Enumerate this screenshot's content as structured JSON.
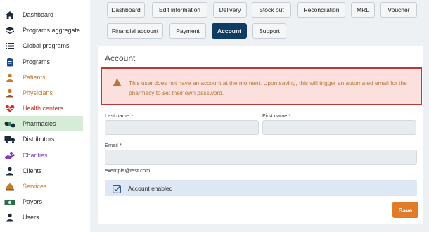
{
  "sidebar": {
    "items": [
      {
        "label": "Dashboard",
        "icon": "home-icon",
        "color": "#2b2b2b"
      },
      {
        "label": "Programs aggregate",
        "icon": "layers-icon",
        "color": "#2b2b2b"
      },
      {
        "label": "Global programs",
        "icon": "list-icon",
        "color": "#2b2b2b"
      },
      {
        "label": "Programs",
        "icon": "clipboard-icon",
        "color": "#2b2b2b"
      },
      {
        "label": "Patients",
        "icon": "patient-icon",
        "color": "#c57a2c"
      },
      {
        "label": "Physicians",
        "icon": "physician-icon",
        "color": "#c57a2c"
      },
      {
        "label": "Health centers",
        "icon": "heart-pulse-icon",
        "color": "#c0392b"
      },
      {
        "label": "Pharmacies",
        "icon": "pills-icon",
        "color": "#2b2b2b"
      },
      {
        "label": "Distributors",
        "icon": "truck-icon",
        "color": "#2b2b2b"
      },
      {
        "label": "Charities",
        "icon": "charity-hand-icon",
        "color": "#7b3fbf"
      },
      {
        "label": "Clients",
        "icon": "user-icon",
        "color": "#2b2b2b"
      },
      {
        "label": "Services",
        "icon": "bell-icon",
        "color": "#c57a2c"
      },
      {
        "label": "Payors",
        "icon": "money-icon",
        "color": "#2b2b2b"
      },
      {
        "label": "Users",
        "icon": "users-icon",
        "color": "#2b2b2b"
      }
    ],
    "active": "Pharmacies"
  },
  "tabs": {
    "dashboard": "Dashboard",
    "edit_information": "Edit information",
    "delivery": "Delivery",
    "stock_out": "Stock out",
    "reconciliation": "Reconcilation",
    "mrl": "MRL",
    "voucher": "Voucher",
    "financial_account": "Financial account",
    "payment": "Payment",
    "account": "Account",
    "support": "Support"
  },
  "account": {
    "title": "Account",
    "alert_text": "This user does not have an account at the moment. Upon saving, this will trigger an automated email for the pharmacy to set their own password.",
    "last_name_label": "Last name *",
    "first_name_label": "First name *",
    "email_label": "Email *",
    "email_hint": "exemple@test.com",
    "last_name_value": "",
    "first_name_value": "",
    "email_value": "",
    "enabled_label": "Account enabled",
    "enabled_checked": true,
    "save_label": "Save"
  },
  "colors": {
    "active_tab": "#0f3c63",
    "save": "#e07b2a",
    "alert_border": "#b73a3a",
    "alert_bg": "#fbe0dd",
    "alert_text": "#b8753b",
    "active_nav_bg": "#d6ecd6"
  }
}
